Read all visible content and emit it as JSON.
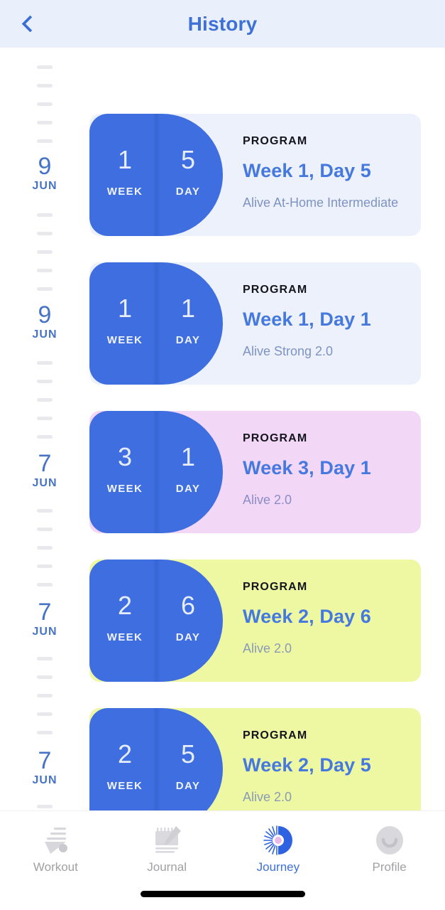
{
  "header": {
    "title": "History",
    "back_icon": "chevron-left-icon"
  },
  "timeline": {
    "entries": [
      {
        "day": "9",
        "month": "JUN"
      },
      {
        "day": "9",
        "month": "JUN"
      },
      {
        "day": "7",
        "month": "JUN"
      },
      {
        "day": "7",
        "month": "JUN"
      },
      {
        "day": "7",
        "month": "JUN"
      }
    ]
  },
  "cards": [
    {
      "week": "1",
      "day": "5",
      "week_caption": "WEEK",
      "day_caption": "DAY",
      "kicker": "PROGRAM",
      "title": "Week 1, Day 5",
      "subtitle": "Alive At-Home Intermediate",
      "bg_color": "#edf1fb",
      "badge_color": "#3f6ee0",
      "subtitle_color": "#7e93c4"
    },
    {
      "week": "1",
      "day": "1",
      "week_caption": "WEEK",
      "day_caption": "DAY",
      "kicker": "PROGRAM",
      "title": "Week 1, Day 1",
      "subtitle": "Alive Strong 2.0",
      "bg_color": "#edf1fb",
      "badge_color": "#3f6ee0",
      "subtitle_color": "#7e93c4"
    },
    {
      "week": "3",
      "day": "1",
      "week_caption": "WEEK",
      "day_caption": "DAY",
      "kicker": "PROGRAM",
      "title": "Week 3, Day 1",
      "subtitle": "Alive 2.0",
      "bg_color": "#f3d7f7",
      "badge_color": "#3f6ee0",
      "subtitle_color": "#8a8ec7"
    },
    {
      "week": "2",
      "day": "6",
      "week_caption": "WEEK",
      "day_caption": "DAY",
      "kicker": "PROGRAM",
      "title": "Week 2, Day 6",
      "subtitle": "Alive 2.0",
      "bg_color": "#eef8a3",
      "badge_color": "#3f6ee0",
      "subtitle_color": "#8a9ab5"
    },
    {
      "week": "2",
      "day": "5",
      "week_caption": "WEEK",
      "day_caption": "DAY",
      "kicker": "PROGRAM",
      "title": "Week 2, Day 5",
      "subtitle": "Alive 2.0",
      "bg_color": "#eef8a3",
      "badge_color": "#3f6ee0",
      "subtitle_color": "#8a9ab5"
    }
  ],
  "bottom_nav": {
    "items": [
      {
        "label": "Workout",
        "icon": "workout-arrow-icon",
        "active": false
      },
      {
        "label": "Journal",
        "icon": "notepad-pencil-icon",
        "active": false
      },
      {
        "label": "Journey",
        "icon": "journey-sunburst-icon",
        "active": true
      },
      {
        "label": "Profile",
        "icon": "profile-avatar-icon",
        "active": false
      }
    ],
    "active_color": "#3e71d8",
    "inactive_color": "#a0a0a6"
  }
}
